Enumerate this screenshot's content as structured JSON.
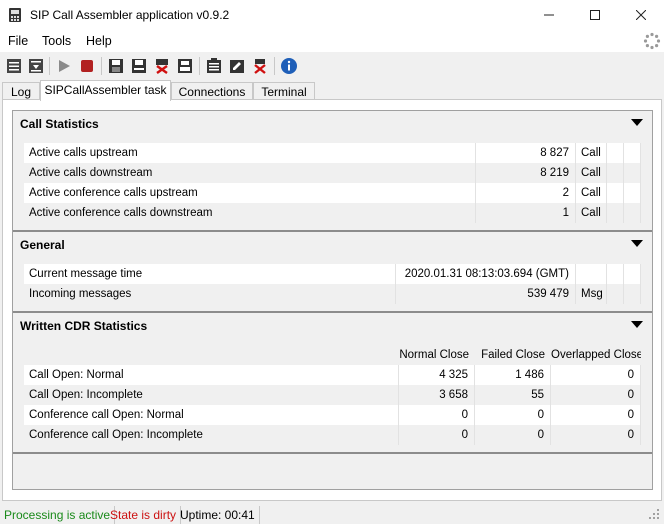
{
  "window": {
    "title": "SIP Call Assembler application v0.9.2",
    "minimize": "—",
    "maximize": "☐",
    "close": "✕"
  },
  "menu": [
    "File",
    "Tools",
    "Help"
  ],
  "toolbar": {
    "icons": [
      "list-icon",
      "list-download-icon",
      "play-icon",
      "stop-icon",
      "save-icon",
      "save-as-icon",
      "delete-red-x-icon",
      "print-icon",
      "clipboard-check-icon",
      "clipboard-edit-icon",
      "clear-red-x-icon",
      "info-icon"
    ]
  },
  "tabs": [
    "Log",
    "SIPCallAssembler task",
    "Connections",
    "Terminal"
  ],
  "active_tab": 1,
  "groups": {
    "call_statistics": {
      "title": "Call Statistics",
      "rows": [
        {
          "label": "Active calls upstream",
          "value": "8 827",
          "unit": "Call"
        },
        {
          "label": "Active calls downstream",
          "value": "8 219",
          "unit": "Call"
        },
        {
          "label": "Active conference calls upstream",
          "value": "2",
          "unit": "Call"
        },
        {
          "label": "Active conference calls downstream",
          "value": "1",
          "unit": "Call"
        }
      ]
    },
    "general": {
      "title": "General",
      "rows": [
        {
          "label": "Current message time",
          "value": "2020.01.31 08:13:03.694 (GMT)",
          "unit": ""
        },
        {
          "label": "Incoming messages",
          "value": "539 479",
          "unit": "Msg"
        }
      ]
    },
    "cdr": {
      "title": "Written CDR Statistics",
      "headers": [
        "Normal Close",
        "Failed Close",
        "Overlapped Close"
      ],
      "rows": [
        {
          "label": "Call Open: Normal",
          "values": [
            "4 325",
            "1 486",
            "0"
          ]
        },
        {
          "label": "Call Open: Incomplete",
          "values": [
            "3 658",
            "55",
            "0"
          ]
        },
        {
          "label": "Conference call Open: Normal",
          "values": [
            "0",
            "0",
            "0"
          ]
        },
        {
          "label": "Conference call Open: Incomplete",
          "values": [
            "0",
            "0",
            "0"
          ]
        }
      ]
    }
  },
  "status": {
    "processing": "Processing is active",
    "state": "State is dirty",
    "uptime": "Uptime: 00:41",
    "colors": {
      "processing": "#1a8a1a",
      "state": "#cc1111"
    }
  }
}
